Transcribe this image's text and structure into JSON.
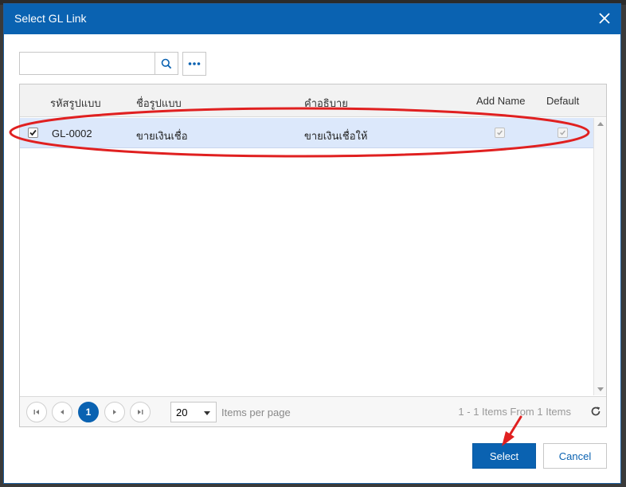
{
  "dialog": {
    "title": "Select GL Link"
  },
  "search": {
    "value": "",
    "placeholder": ""
  },
  "grid": {
    "columns": [
      "รหัสรูปแบบ",
      "ชื่อรูปแบบ",
      "คำอธิบาย",
      "Add Name",
      "Default"
    ],
    "rows": [
      {
        "selected": true,
        "code": "GL-0002",
        "name": "ขายเงินเชื่อ",
        "description": "ขายเงินเชื่อให้",
        "add_name": true,
        "default": true
      }
    ]
  },
  "pager": {
    "current_page": "1",
    "page_size": "20",
    "items_per_page_label": "Items per page",
    "info": "1 - 1 Items From 1 Items"
  },
  "buttons": {
    "select": "Select",
    "cancel": "Cancel"
  },
  "colors": {
    "accent": "#0a62b1",
    "selected_row": "#dce8fb",
    "annotation": "#e02020"
  }
}
